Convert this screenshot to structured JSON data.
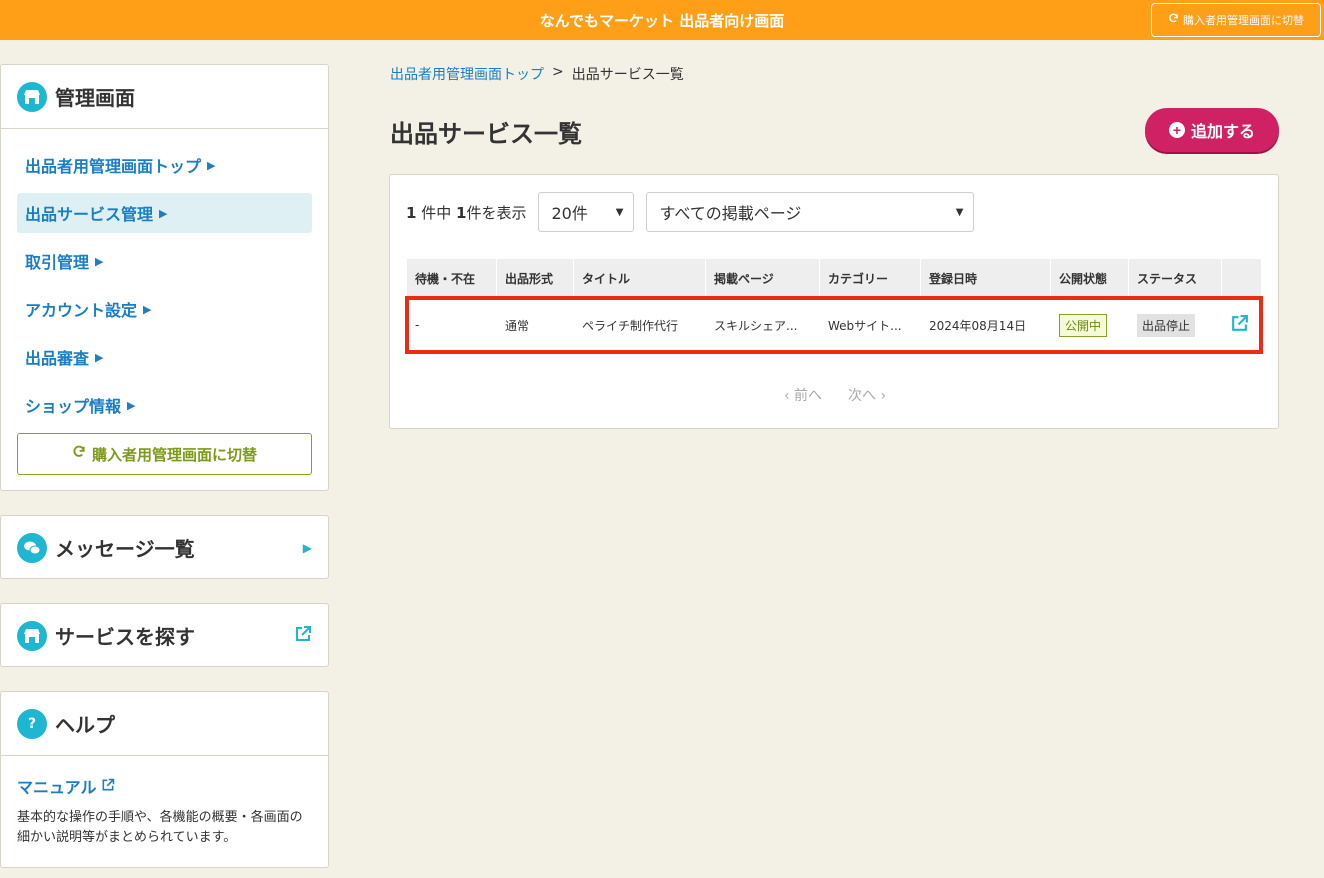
{
  "topbar": {
    "title": "なんでもマーケット 出品者向け画面",
    "switch_label": "購入者用管理画面に切替"
  },
  "sidebar": {
    "admin": {
      "title": "管理画面",
      "items": [
        {
          "label": "出品者用管理画面トップ"
        },
        {
          "label": "出品サービス管理"
        },
        {
          "label": "取引管理"
        },
        {
          "label": "アカウント設定"
        },
        {
          "label": "出品審査"
        },
        {
          "label": "ショップ情報"
        }
      ],
      "switch_label": "購入者用管理画面に切替"
    },
    "messages": {
      "title": "メッセージ一覧"
    },
    "search": {
      "title": "サービスを探す"
    },
    "help": {
      "title": "ヘルプ",
      "link_label": "マニュアル",
      "description": "基本的な操作の手順や、各機能の概要・各画面の細かい説明等がまとめられています。"
    }
  },
  "breadcrumb": {
    "parent": "出品者用管理画面トップ",
    "separator": ">",
    "current": "出品サービス一覧"
  },
  "page": {
    "title": "出品サービス一覧",
    "add_label": "追加する"
  },
  "panel": {
    "count_prefix": "1",
    "count_mid": "件中",
    "count_shown": "1",
    "count_suffix": "件を表示",
    "per_page": "20件",
    "page_filter": "すべての掲載ページ"
  },
  "table": {
    "headers": [
      "待機・不在",
      "出品形式",
      "タイトル",
      "掲載ページ",
      "カテゴリー",
      "登録日時",
      "公開状態",
      "ステータス",
      ""
    ],
    "rows": [
      {
        "presence": "-",
        "format": "通常",
        "title": "ペライチ制作代行",
        "page": "スキルシェア...",
        "category": "Webサイト...",
        "registered": "2024年08月14日",
        "publish_state": "公開中",
        "status": "出品停止"
      }
    ]
  },
  "pager": {
    "prev": "前へ",
    "next": "次へ"
  },
  "colors": {
    "topbar": "#ff9e17",
    "accent": "#1eb6d0",
    "link": "#1a7ec5",
    "add_button": "#cf2164",
    "highlight": "#ef2a13"
  }
}
